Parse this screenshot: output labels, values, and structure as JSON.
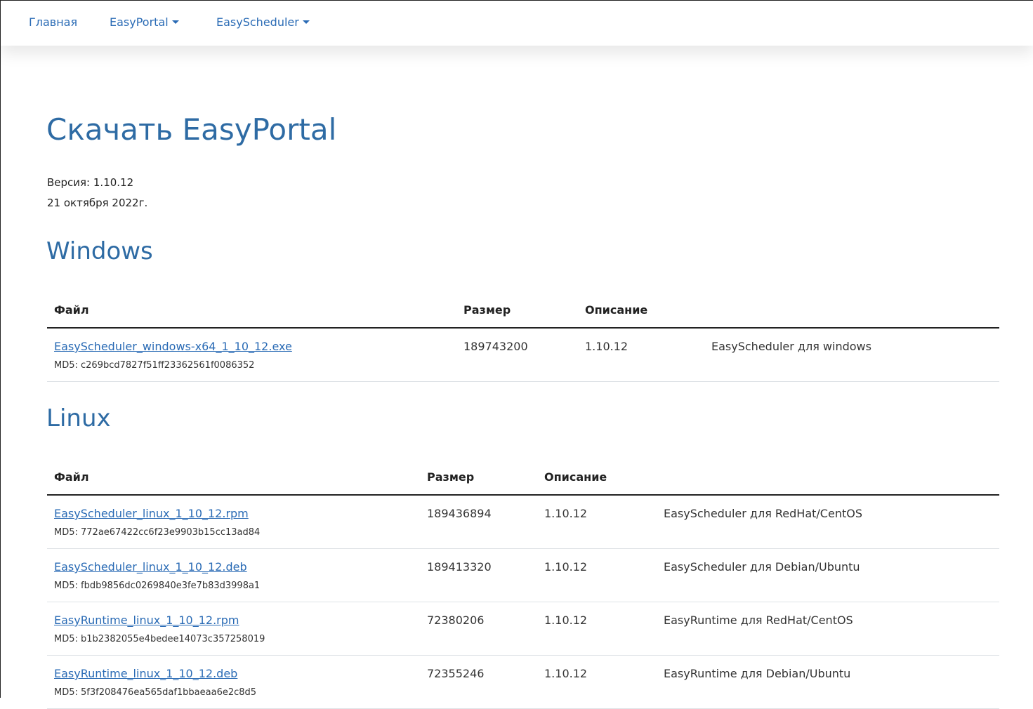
{
  "nav": {
    "home": "Главная",
    "easyportal": "EasyPortal",
    "easyscheduler": "EasyScheduler"
  },
  "page": {
    "title": "Скачать EasyPortal",
    "version": "Версия: 1.10.12",
    "date": "21 октября 2022г."
  },
  "windows": {
    "title": "Windows",
    "headers": {
      "file": "Файл",
      "size": "Размер",
      "description": "Описание"
    },
    "rows": [
      {
        "file": "EasyScheduler_windows-x64_1_10_12.exe",
        "md5": "MD5: c269bcd7827f51ff23362561f0086352",
        "size": "189743200",
        "version": "1.10.12",
        "description": "EasyScheduler для windows"
      }
    ]
  },
  "linux": {
    "title": "Linux",
    "headers": {
      "file": "Файл",
      "size": "Размер",
      "description": "Описание"
    },
    "rows": [
      {
        "file": "EasyScheduler_linux_1_10_12.rpm",
        "md5": "MD5: 772ae67422cc6f23e9903b15cc13ad84",
        "size": "189436894",
        "version": "1.10.12",
        "description": "EasyScheduler для RedHat/CentOS"
      },
      {
        "file": "EasyScheduler_linux_1_10_12.deb",
        "md5": "MD5: fbdb9856dc0269840e3fe7b83d3998a1",
        "size": "189413320",
        "version": "1.10.12",
        "description": "EasyScheduler для Debian/Ubuntu"
      },
      {
        "file": "EasyRuntime_linux_1_10_12.rpm",
        "md5": "MD5: b1b2382055e4bedee14073c357258019",
        "size": "72380206",
        "version": "1.10.12",
        "description": "EasyRuntime для RedHat/CentOS"
      },
      {
        "file": "EasyRuntime_linux_1_10_12.deb",
        "md5": "MD5: 5f3f208476ea565daf1bbaeaa6e2c8d5",
        "size": "72355246",
        "version": "1.10.12",
        "description": "EasyRuntime для Debian/Ubuntu"
      }
    ]
  }
}
